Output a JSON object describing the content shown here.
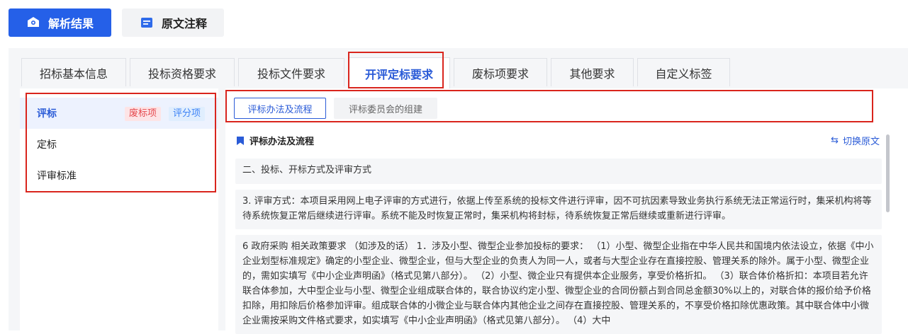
{
  "header": {
    "primary_label": "解析结果",
    "secondary_label": "原文注释"
  },
  "tabs": [
    {
      "label": "招标基本信息"
    },
    {
      "label": "投标资格要求"
    },
    {
      "label": "投标文件要求"
    },
    {
      "label": "开评定标要求",
      "active": true
    },
    {
      "label": "废标项要求"
    },
    {
      "label": "其他要求"
    },
    {
      "label": "自定义标签"
    }
  ],
  "sidebar": {
    "items": [
      {
        "label": "评标",
        "badges": [
          "废标项",
          "评分项"
        ],
        "active": true
      },
      {
        "label": "定标"
      },
      {
        "label": "评审标准"
      }
    ]
  },
  "subtabs": [
    {
      "label": "评标办法及流程",
      "active": true
    },
    {
      "label": "评标委员会的组建"
    }
  ],
  "section": {
    "title": "评标办法及流程",
    "switch_label": "切换原文"
  },
  "paragraphs": [
    "二、投标、开标方式及评审方式",
    "3. 评审方式：本项目采用网上电子评审的方式进行，依据上传至系统的投标文件进行评审，因不可抗因素导致业务执行系统无法正常运行时，集采机构将等待系统恢复正常后继续进行评审。系统不能及时恢复正常时，集采机构将封标，待系统恢复正常后继续或重新进行评审。",
    "6 政府采购 相关政策要求 （如涉及的话） 1．涉及小型、微型企业参加投标的要求： （1）小型、微型企业指在中华人民共和国境内依法设立，依据《中小企业划型标准规定》确定的小型企业、微型企业，但与大型企业的负责人为同一人，或者与大型企业存在直接控股、管理关系的除外。属于小型、微型企业的，需如实填写《中小企业声明函》（格式见第八部分）。 （2）小型、微企业只有提供本企业服务，享受价格折扣。 （3）联合体价格折扣：本项目若允许联合体参加，大中型企业与小型、微型企业组成联合体的，联合协议约定小型、微型企业的合同份额占到合同总金额30%以上的，对联合体的报价给予价格扣除，用扣除后价格参加评审。组成联合体的小微企业与联合体内其他企业之间存在直接控股、管理关系的，不享受价格扣除优惠政策。其中联合体中小微企业需按采购文件格式要求，如实填写《中小企业声明函》（格式见第八部分）。 （4）大中"
  ],
  "colors": {
    "primary": "#2560e8",
    "accent": "#2a5bd7",
    "highlight_outline": "#d9251d"
  }
}
